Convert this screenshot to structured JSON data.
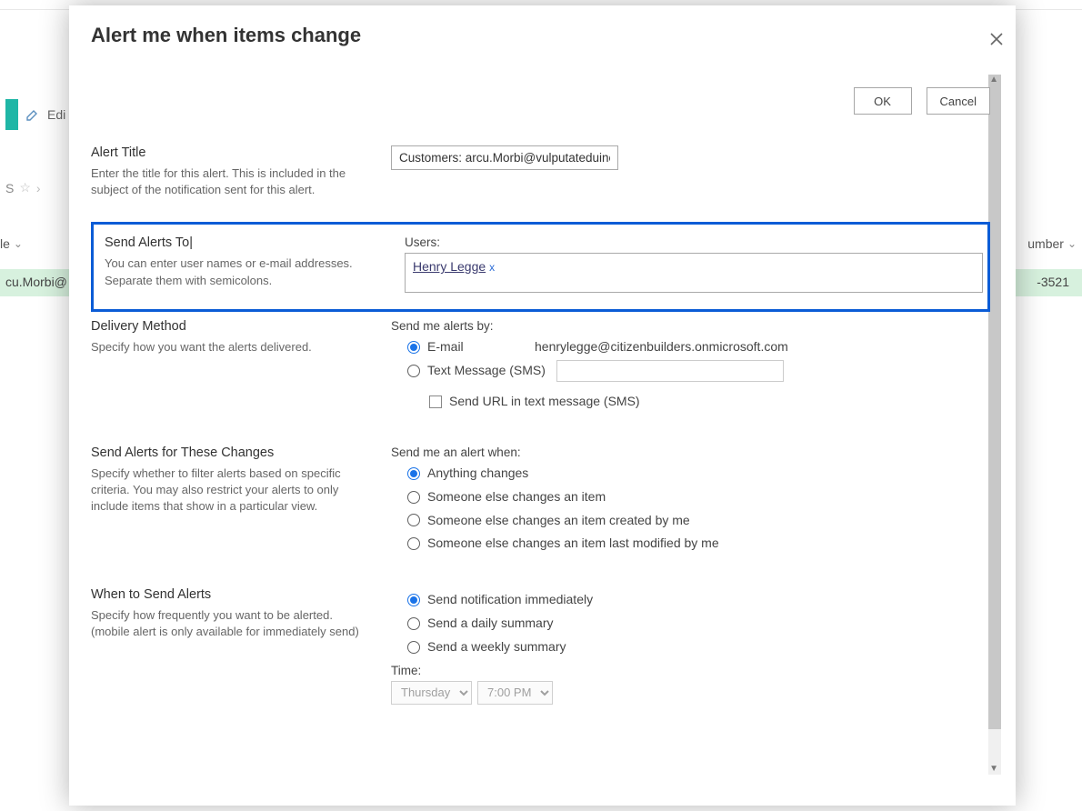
{
  "background": {
    "edit_label": "Edi",
    "star_row_text": "S",
    "column_left": "le",
    "column_right": "umber",
    "row_left": "cu.Morbi@",
    "row_right": "-3521"
  },
  "dialog": {
    "title": "Alert me when items change",
    "ok": "OK",
    "cancel": "Cancel"
  },
  "alert_title": {
    "heading": "Alert Title",
    "desc": "Enter the title for this alert. This is included in the subject of the notification sent for this alert.",
    "value": "Customers: arcu.Morbi@vulputateduinec."
  },
  "send_to": {
    "heading": "Send Alerts To",
    "desc": "You can enter user names or e-mail addresses. Separate them with semicolons.",
    "users_label": "Users:",
    "user_name": "Henry Legge",
    "chip_x": "x"
  },
  "delivery": {
    "heading": "Delivery Method",
    "desc": "Specify how you want the alerts delivered.",
    "send_by_label": "Send me alerts by:",
    "opt_email": "E-mail",
    "email_address": "henrylegge@citizenbuilders.onmicrosoft.com",
    "opt_sms": "Text Message (SMS)",
    "chk_send_url": "Send URL in text message (SMS)"
  },
  "changes": {
    "heading": "Send Alerts for These Changes",
    "desc": "Specify whether to filter alerts based on specific criteria. You may also restrict your alerts to only include items that show in a particular view.",
    "send_when_label": "Send me an alert when:",
    "opt_anything": "Anything changes",
    "opt_else_item": "Someone else changes an item",
    "opt_else_created": "Someone else changes an item created by me",
    "opt_else_modified": "Someone else changes an item last modified by me"
  },
  "when": {
    "heading": "When to Send Alerts",
    "desc": "Specify how frequently you want to be alerted. (mobile alert is only available for immediately send)",
    "opt_immediately": "Send notification immediately",
    "opt_daily": "Send a daily summary",
    "opt_weekly": "Send a weekly summary",
    "time_label": "Time:",
    "day_value": "Thursday",
    "hour_value": "7:00 PM"
  }
}
